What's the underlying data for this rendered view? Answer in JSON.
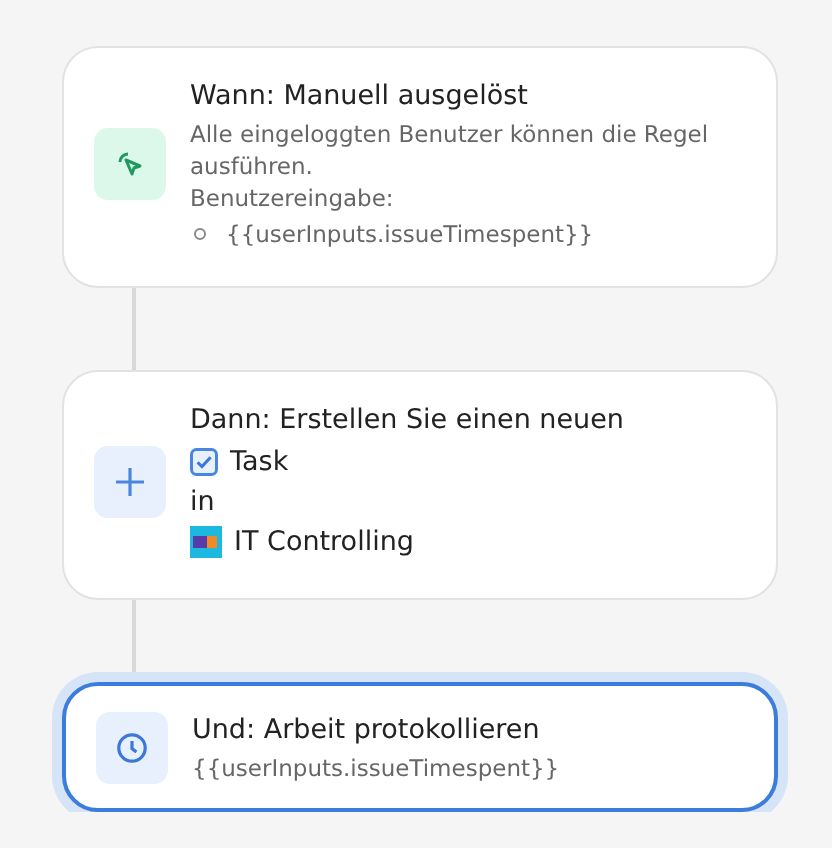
{
  "steps": [
    {
      "kind": "trigger",
      "selected": false,
      "title": "Wann: Manuell ausgelöst",
      "lines": [
        {
          "kind": "note",
          "text": "Alle eingeloggten Benutzer können die Regel ausführen."
        },
        {
          "kind": "note",
          "text": "Benutzereingabe:"
        },
        {
          "kind": "bullet",
          "text": "{{userInputs.issueTimespent}}"
        }
      ]
    },
    {
      "kind": "action",
      "selected": false,
      "title": "Dann: Erstellen Sie einen neuen",
      "lines": [
        {
          "kind": "issue-type",
          "text": "Task"
        },
        {
          "kind": "plain",
          "text": "in"
        },
        {
          "kind": "project",
          "text": "IT Controlling"
        }
      ]
    },
    {
      "kind": "log",
      "selected": true,
      "title": "Und: Arbeit protokollieren",
      "lines": [
        {
          "kind": "note",
          "text": "{{userInputs.issueTimespent}}"
        }
      ]
    }
  ]
}
